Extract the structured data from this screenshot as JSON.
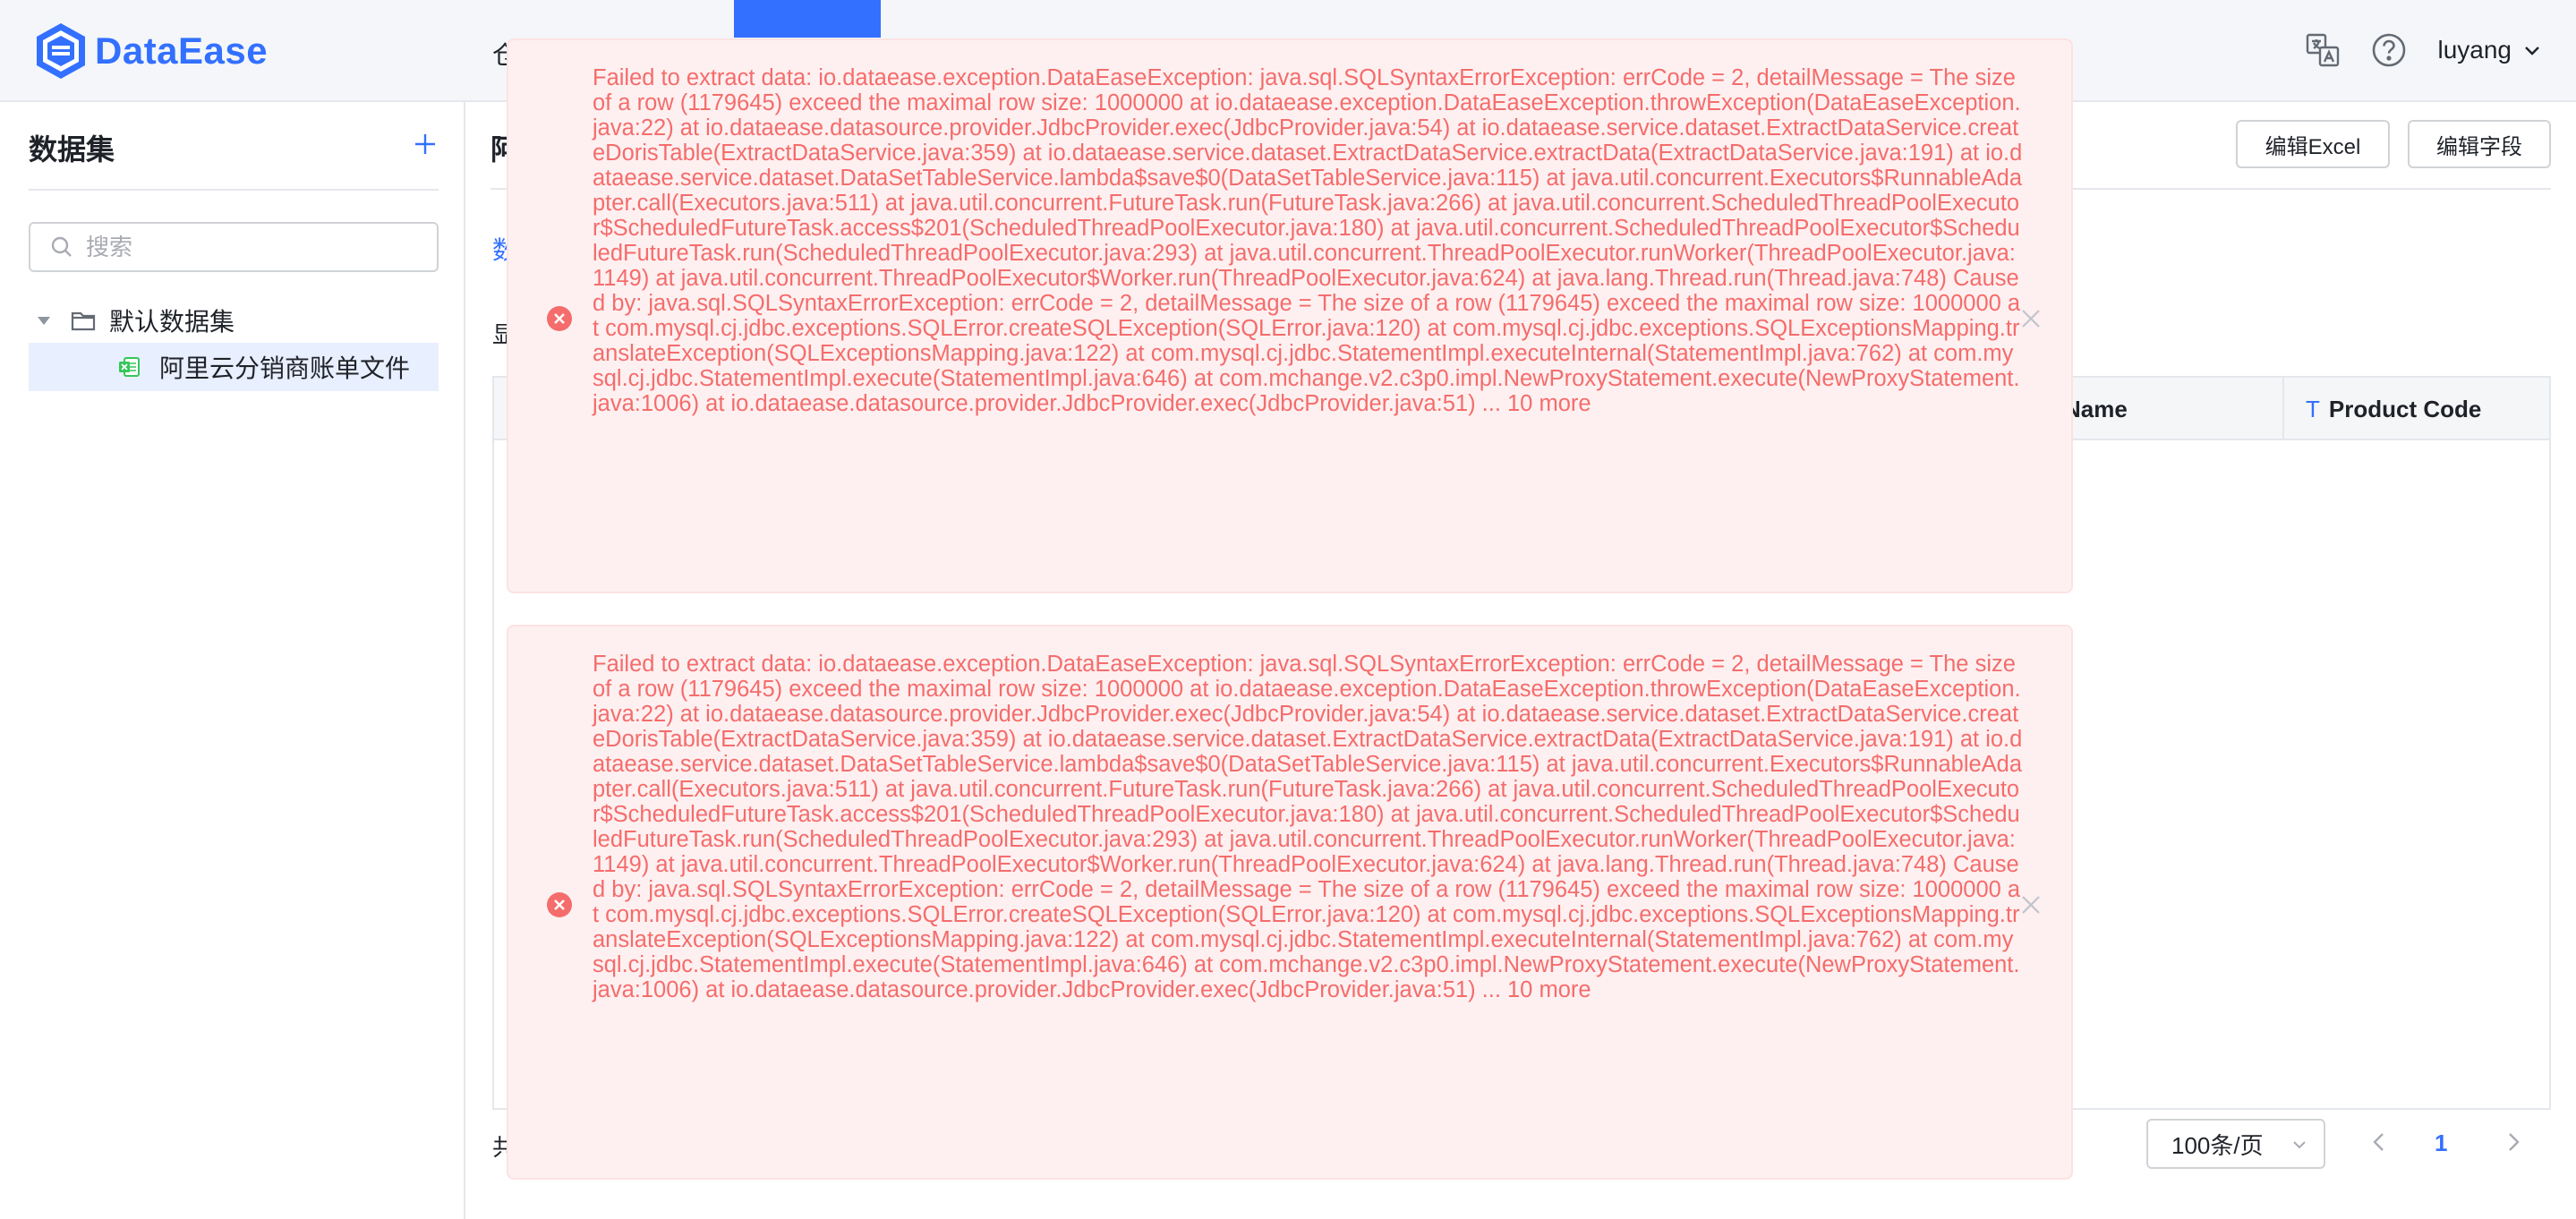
{
  "header": {
    "app_name": "DataEase",
    "nav_cut_text": "仓",
    "user_name": "luyang",
    "icons": [
      "translate-icon",
      "help-icon",
      "chevron-down-icon"
    ],
    "accent_color": "#3370ff"
  },
  "sidebar": {
    "title": "数据集",
    "search_placeholder": "搜索",
    "tree": {
      "folder_label": "默认数据集",
      "file_label": "阿里云分销商账单文件"
    }
  },
  "main": {
    "title_cut": "阿",
    "buttons": {
      "edit_excel": "编辑Excel",
      "edit_fields": "编辑字段"
    },
    "tab_cut": "数",
    "row_label_cut": "显",
    "table": {
      "columns": [
        "Name",
        "Product Code"
      ],
      "product_code_type_icon": "T"
    },
    "footer": {
      "total_cut": "共",
      "page_size": "100条/页",
      "current_page": "1"
    }
  },
  "toasts": [
    {
      "type": "error",
      "color": "#f56c6c",
      "message": "Failed to extract data: io.dataease.exception.DataEaseException: java.sql.SQLSyntaxErrorException: errCode = 2, detailMessage = The size of a row (1179645) exceed the maximal row size: 1000000 at io.dataease.exception.DataEaseException.throwException(DataEaseException.java:22) at io.dataease.datasource.provider.JdbcProvider.exec(JdbcProvider.java:54) at io.dataease.service.dataset.ExtractDataService.createDorisTable(ExtractDataService.java:359) at io.dataease.service.dataset.ExtractDataService.extractData(ExtractDataService.java:191) at io.dataease.service.dataset.DataSetTableService.lambda$save$0(DataSetTableService.java:115) at java.util.concurrent.Executors$RunnableAdapter.call(Executors.java:511) at java.util.concurrent.FutureTask.run(FutureTask.java:266) at java.util.concurrent.ScheduledThreadPoolExecutor$ScheduledFutureTask.access$201(ScheduledThreadPoolExecutor.java:180) at java.util.concurrent.ScheduledThreadPoolExecutor$ScheduledFutureTask.run(ScheduledThreadPoolExecutor.java:293) at java.util.concurrent.ThreadPoolExecutor.runWorker(ThreadPoolExecutor.java:1149) at java.util.concurrent.ThreadPoolExecutor$Worker.run(ThreadPoolExecutor.java:624) at java.lang.Thread.run(Thread.java:748) Caused by: java.sql.SQLSyntaxErrorException: errCode = 2, detailMessage = The size of a row (1179645) exceed the maximal row size: 1000000 at com.mysql.cj.jdbc.exceptions.SQLError.createSQLException(SQLError.java:120) at com.mysql.cj.jdbc.exceptions.SQLExceptionsMapping.translateException(SQLExceptionsMapping.java:122) at com.mysql.cj.jdbc.StatementImpl.executeInternal(StatementImpl.java:762) at com.mysql.cj.jdbc.StatementImpl.execute(StatementImpl.java:646) at com.mchange.v2.c3p0.impl.NewProxyStatement.execute(NewProxyStatement.java:1006) at io.dataease.datasource.provider.JdbcProvider.exec(JdbcProvider.java:51) ... 10 more"
    },
    {
      "type": "error",
      "color": "#f56c6c",
      "message": "Failed to extract data: io.dataease.exception.DataEaseException: java.sql.SQLSyntaxErrorException: errCode = 2, detailMessage = The size of a row (1179645) exceed the maximal row size: 1000000 at io.dataease.exception.DataEaseException.throwException(DataEaseException.java:22) at io.dataease.datasource.provider.JdbcProvider.exec(JdbcProvider.java:54) at io.dataease.service.dataset.ExtractDataService.createDorisTable(ExtractDataService.java:359) at io.dataease.service.dataset.ExtractDataService.extractData(ExtractDataService.java:191) at io.dataease.service.dataset.DataSetTableService.lambda$save$0(DataSetTableService.java:115) at java.util.concurrent.Executors$RunnableAdapter.call(Executors.java:511) at java.util.concurrent.FutureTask.run(FutureTask.java:266) at java.util.concurrent.ScheduledThreadPoolExecutor$ScheduledFutureTask.access$201(ScheduledThreadPoolExecutor.java:180) at java.util.concurrent.ScheduledThreadPoolExecutor$ScheduledFutureTask.run(ScheduledThreadPoolExecutor.java:293) at java.util.concurrent.ThreadPoolExecutor.runWorker(ThreadPoolExecutor.java:1149) at java.util.concurrent.ThreadPoolExecutor$Worker.run(ThreadPoolExecutor.java:624) at java.lang.Thread.run(Thread.java:748) Caused by: java.sql.SQLSyntaxErrorException: errCode = 2, detailMessage = The size of a row (1179645) exceed the maximal row size: 1000000 at com.mysql.cj.jdbc.exceptions.SQLError.createSQLException(SQLError.java:120) at com.mysql.cj.jdbc.exceptions.SQLExceptionsMapping.translateException(SQLExceptionsMapping.java:122) at com.mysql.cj.jdbc.StatementImpl.executeInternal(StatementImpl.java:762) at com.mysql.cj.jdbc.StatementImpl.execute(StatementImpl.java:646) at com.mchange.v2.c3p0.impl.NewProxyStatement.execute(NewProxyStatement.java:1006) at io.dataease.datasource.provider.JdbcProvider.exec(JdbcProvider.java:51) ... 10 more"
    }
  ]
}
